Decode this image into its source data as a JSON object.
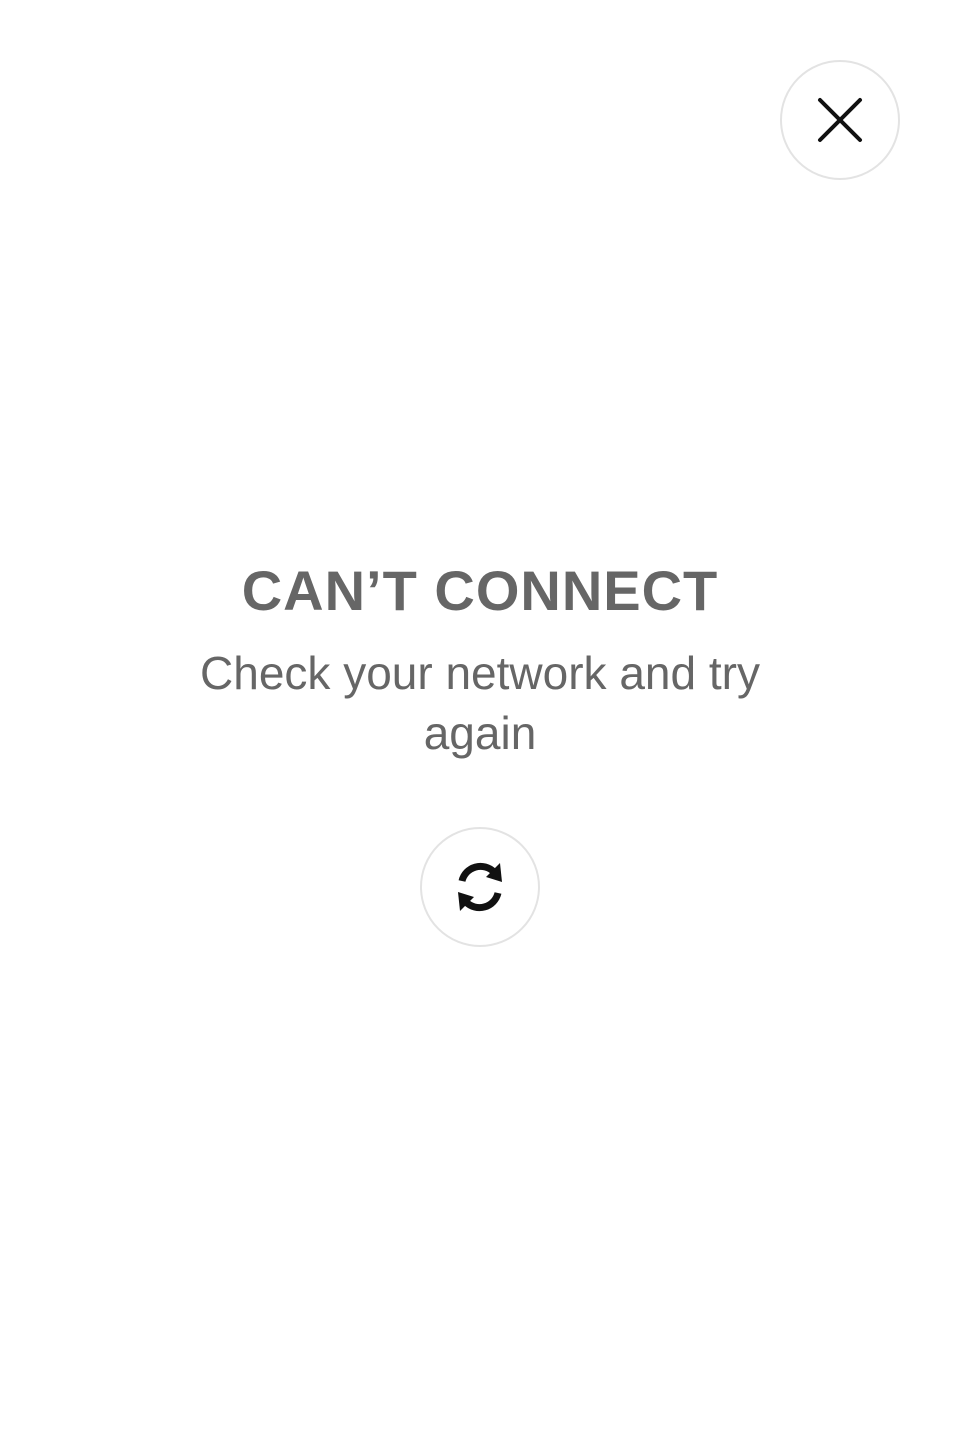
{
  "close_button": {
    "icon": "close-icon",
    "border_color": "#e3e3e3"
  },
  "error": {
    "title": "CAN’T CONNECT",
    "message": "Check your network and try again",
    "text_color": "#666666"
  },
  "retry_button": {
    "icon": "refresh-icon",
    "border_color": "#e3e3e3"
  }
}
